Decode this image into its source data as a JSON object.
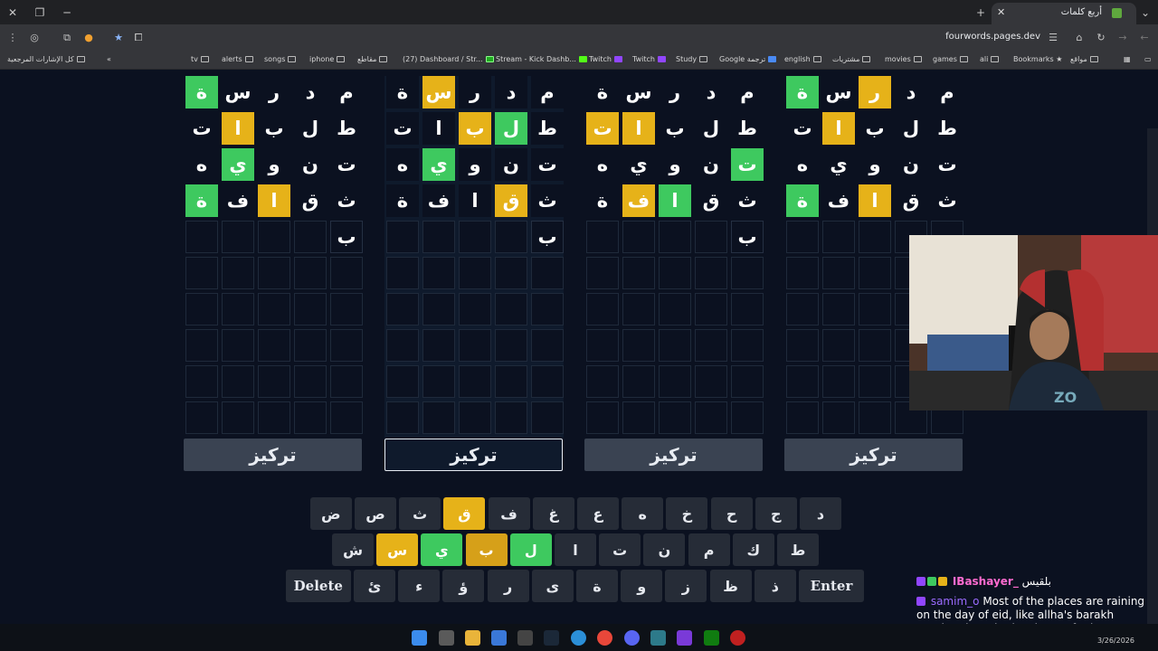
{
  "browser": {
    "tab_title": "أربع كلمات",
    "url": "fourwords.pages.dev",
    "bookmarks_right_to_left": [
      "مواقع",
      "Bookmarks",
      "ali",
      "games",
      "movies",
      "مشتريات",
      "english",
      "Google ترجمة",
      "Study",
      "Twitch",
      "Twitch",
      "Stream - Kick Dashb...",
      "(27) Dashboard / Str...",
      "مقاطع",
      "iphone",
      "songs",
      "alerts",
      "tv"
    ],
    "all_bookmarks": "كل الإشارات المرجعية"
  },
  "boards": [
    {
      "focus_label": "تركيز",
      "focused": false,
      "rows": [
        {
          "letters": [
            "م",
            "د",
            "ر",
            "س",
            "ة"
          ],
          "states": [
            "n",
            "n",
            "n",
            "n",
            "g"
          ]
        },
        {
          "letters": [
            "ط",
            "ل",
            "ب",
            "ا",
            "ت"
          ],
          "states": [
            "n",
            "n",
            "n",
            "y",
            "n"
          ]
        },
        {
          "letters": [
            "ت",
            "ن",
            "و",
            "ي",
            "ه"
          ],
          "states": [
            "n",
            "n",
            "n",
            "g",
            "n"
          ]
        },
        {
          "letters": [
            "ث",
            "ق",
            "ا",
            "ف",
            "ة"
          ],
          "states": [
            "n",
            "n",
            "y",
            "n",
            "g"
          ]
        },
        {
          "letters": [
            "ب",
            "",
            "",
            "",
            ""
          ],
          "states": [
            "s",
            "e",
            "e",
            "e",
            "e"
          ]
        }
      ]
    },
    {
      "focus_label": "تركيز",
      "focused": true,
      "rows": [
        {
          "letters": [
            "م",
            "د",
            "ر",
            "س",
            "ة"
          ],
          "states": [
            "n",
            "n",
            "n",
            "y",
            "n"
          ]
        },
        {
          "letters": [
            "ط",
            "ل",
            "ب",
            "ا",
            "ت"
          ],
          "states": [
            "n",
            "g",
            "y",
            "n",
            "n"
          ]
        },
        {
          "letters": [
            "ت",
            "ن",
            "و",
            "ي",
            "ه"
          ],
          "states": [
            "n",
            "n",
            "n",
            "g",
            "n"
          ]
        },
        {
          "letters": [
            "ث",
            "ق",
            "ا",
            "ف",
            "ة"
          ],
          "states": [
            "n",
            "y",
            "n",
            "n",
            "n"
          ]
        },
        {
          "letters": [
            "ب",
            "",
            "",
            "",
            ""
          ],
          "states": [
            "s",
            "e",
            "e",
            "e",
            "e"
          ]
        }
      ]
    },
    {
      "focus_label": "تركيز",
      "focused": false,
      "rows": [
        {
          "letters": [
            "م",
            "د",
            "ر",
            "س",
            "ة"
          ],
          "states": [
            "n",
            "n",
            "n",
            "n",
            "n"
          ]
        },
        {
          "letters": [
            "ط",
            "ل",
            "ب",
            "ا",
            "ت"
          ],
          "states": [
            "n",
            "n",
            "n",
            "y",
            "y"
          ]
        },
        {
          "letters": [
            "ت",
            "ن",
            "و",
            "ي",
            "ه"
          ],
          "states": [
            "g",
            "n",
            "n",
            "n",
            "n"
          ]
        },
        {
          "letters": [
            "ث",
            "ق",
            "ا",
            "ف",
            "ة"
          ],
          "states": [
            "n",
            "n",
            "g",
            "y",
            "n"
          ]
        },
        {
          "letters": [
            "ب",
            "",
            "",
            "",
            ""
          ],
          "states": [
            "s",
            "e",
            "e",
            "e",
            "e"
          ]
        }
      ]
    },
    {
      "focus_label": "تركيز",
      "focused": false,
      "rows": [
        {
          "letters": [
            "م",
            "د",
            "ر",
            "س",
            "ة"
          ],
          "states": [
            "n",
            "n",
            "y",
            "n",
            "g"
          ]
        },
        {
          "letters": [
            "ط",
            "ل",
            "ب",
            "ا",
            "ت"
          ],
          "states": [
            "n",
            "n",
            "n",
            "y",
            "n"
          ]
        },
        {
          "letters": [
            "ت",
            "ن",
            "و",
            "ي",
            "ه"
          ],
          "states": [
            "n",
            "n",
            "n",
            "n",
            "n"
          ]
        },
        {
          "letters": [
            "ث",
            "ق",
            "ا",
            "ف",
            "ة"
          ],
          "states": [
            "n",
            "n",
            "y",
            "n",
            "g"
          ]
        },
        {
          "letters": [
            "",
            "",
            "",
            "",
            ""
          ],
          "states": [
            "e",
            "e",
            "e",
            "e",
            "e"
          ]
        }
      ]
    }
  ],
  "keyboard": {
    "row1": [
      {
        "k": "د",
        "s": "n"
      },
      {
        "k": "ج",
        "s": "n"
      },
      {
        "k": "ح",
        "s": "n"
      },
      {
        "k": "خ",
        "s": "n"
      },
      {
        "k": "ه",
        "s": "n"
      },
      {
        "k": "ع",
        "s": "n"
      },
      {
        "k": "غ",
        "s": "n"
      },
      {
        "k": "ف",
        "s": "n"
      },
      {
        "k": "ق",
        "s": "y"
      },
      {
        "k": "ث",
        "s": "n"
      },
      {
        "k": "ص",
        "s": "n"
      },
      {
        "k": "ض",
        "s": "n"
      }
    ],
    "row2": [
      {
        "k": "ط",
        "s": "n"
      },
      {
        "k": "ك",
        "s": "n"
      },
      {
        "k": "م",
        "s": "n"
      },
      {
        "k": "ن",
        "s": "n"
      },
      {
        "k": "ت",
        "s": "n"
      },
      {
        "k": "ا",
        "s": "n"
      },
      {
        "k": "ل",
        "s": "g"
      },
      {
        "k": "ب",
        "s": "b"
      },
      {
        "k": "ي",
        "s": "g"
      },
      {
        "k": "س",
        "s": "y"
      },
      {
        "k": "ش",
        "s": "n"
      }
    ],
    "row3": [
      {
        "k": "Enter",
        "s": "n"
      },
      {
        "k": "ذ",
        "s": "n"
      },
      {
        "k": "ظ",
        "s": "n"
      },
      {
        "k": "ز",
        "s": "n"
      },
      {
        "k": "و",
        "s": "n"
      },
      {
        "k": "ة",
        "s": "n"
      },
      {
        "k": "ى",
        "s": "n"
      },
      {
        "k": "ر",
        "s": "n"
      },
      {
        "k": "ؤ",
        "s": "n"
      },
      {
        "k": "ء",
        "s": "n"
      },
      {
        "k": "ئ",
        "s": "n"
      },
      {
        "k": "Delete",
        "s": "n"
      }
    ]
  },
  "chat": [
    {
      "user": "IBashayer_",
      "alias": "بلقيس",
      "text": ""
    },
    {
      "user": "samim_o",
      "text": "Most of the places are raining on the day of eid, like allha's barakh pouring down in the shape of rain"
    }
  ],
  "clock": "3/26/2026",
  "colors": {
    "correct": "#3ec95f",
    "present": "#e6b219",
    "background": "#0b1120",
    "key": "#262c37"
  }
}
